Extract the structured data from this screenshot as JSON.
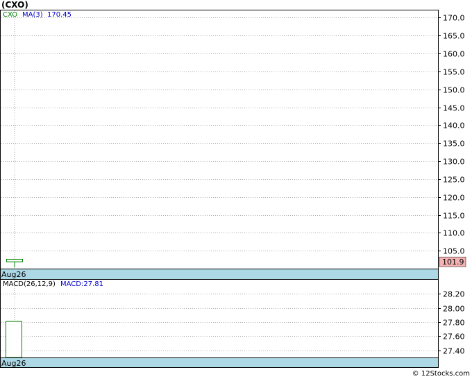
{
  "title": "(CXO)",
  "watermark": "© 12Stocks.com",
  "chart_data": [
    {
      "type": "candlestick",
      "legend": {
        "symbol": "CXO",
        "ma_label": "MA(3)",
        "ma_value": "170.45"
      },
      "x_label": "Aug26",
      "ylim": [
        100,
        172
      ],
      "yticks": [
        105,
        110,
        115,
        120,
        125,
        130,
        135,
        140,
        145,
        150,
        155,
        160,
        165,
        170
      ],
      "ytick_labels": [
        "105.0",
        "110.0",
        "115.0",
        "120.0",
        "125.0",
        "130.0",
        "135.0",
        "140.0",
        "145.0",
        "150.0",
        "155.0",
        "160.0",
        "165.0",
        "170.0"
      ],
      "candles": [
        {
          "date": "Aug26",
          "open": 101.9,
          "high": 102.6,
          "low": 100.3,
          "close": 102.6
        }
      ],
      "last_price_label": "101.9",
      "last_price": 101.9,
      "grid": true,
      "colors": {
        "up": "#008000",
        "legend_symbol": "#008000",
        "legend_ma": "#0000cc",
        "price_tag": "#f4b2b2",
        "axis_band": "#add8e6",
        "grid": "#aaaaaa"
      }
    },
    {
      "type": "bar",
      "legend": {
        "label": "MACD(26,12,9)",
        "macd_label": "MACD:27.81"
      },
      "x_label": "Aug26",
      "ylim": [
        27.3,
        28.4
      ],
      "yticks": [
        27.4,
        27.6,
        27.8,
        28.0,
        28.2
      ],
      "ytick_labels": [
        "27.40",
        "27.60",
        "27.80",
        "28.00",
        "28.20"
      ],
      "bars": [
        {
          "date": "Aug26",
          "value": 27.81
        }
      ],
      "grid": true,
      "colors": {
        "bar": "#008000",
        "legend_macd": "#0000cc",
        "axis_band": "#add8e6",
        "grid": "#aaaaaa"
      }
    }
  ]
}
